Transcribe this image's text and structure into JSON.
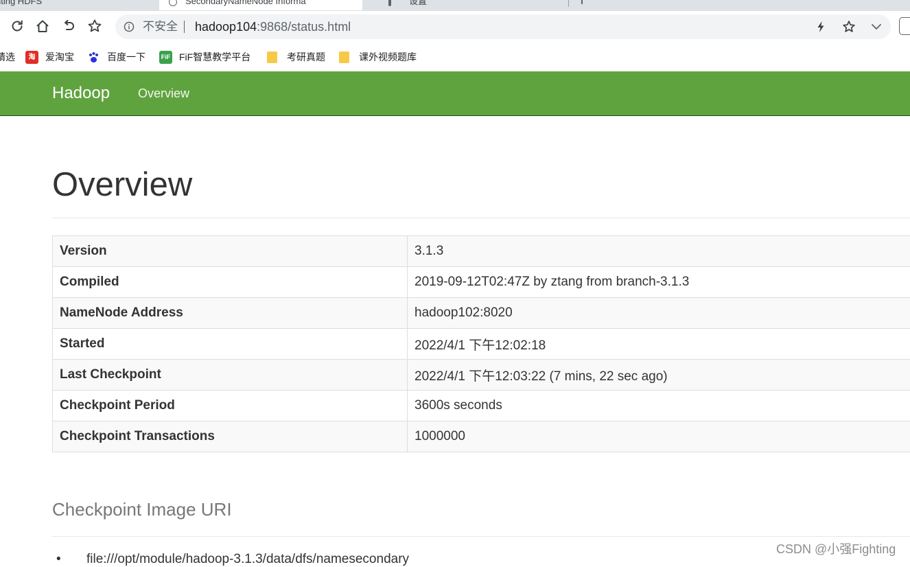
{
  "browser": {
    "tabs": [
      {
        "label": "nting HDFS"
      },
      {
        "label": "SecondaryNameNode Informa"
      },
      {
        "label": "设置"
      }
    ],
    "address": {
      "security_label": "不安全",
      "url_host": "hadoop104",
      "url_rest": ":9868/status.html"
    },
    "bookmarks": [
      {
        "label": "精选"
      },
      {
        "label": "爱淘宝",
        "icon": "taobao-icon"
      },
      {
        "label": "百度一下",
        "icon": "baidu-paw-icon"
      },
      {
        "label": "FiF智慧教学平台",
        "icon": "fif-icon"
      },
      {
        "label": "考研真题",
        "icon": "folder-icon"
      },
      {
        "label": "课外视频题库",
        "icon": "folder-icon"
      }
    ]
  },
  "navbar": {
    "brand": "Hadoop",
    "links": [
      {
        "label": "Overview"
      }
    ],
    "color": "#5fa33e"
  },
  "page": {
    "title": "Overview",
    "info_rows": [
      {
        "key": "Version",
        "value": "3.1.3"
      },
      {
        "key": "Compiled",
        "value": "2019-09-12T02:47Z by ztang from branch-3.1.3"
      },
      {
        "key": "NameNode Address",
        "value": "hadoop102:8020"
      },
      {
        "key": "Started",
        "value": "2022/4/1 下午12:02:18"
      },
      {
        "key": "Last Checkpoint",
        "value": "2022/4/1 下午12:03:22 (7 mins, 22 sec ago)"
      },
      {
        "key": "Checkpoint Period",
        "value": "3600s seconds"
      },
      {
        "key": "Checkpoint Transactions",
        "value": "1000000"
      }
    ],
    "checkpoint_section_title": "Checkpoint Image URI",
    "checkpoint_uris": [
      "file:///opt/module/hadoop-3.1.3/data/dfs/namesecondary"
    ]
  },
  "watermark": "CSDN @小强Fighting"
}
